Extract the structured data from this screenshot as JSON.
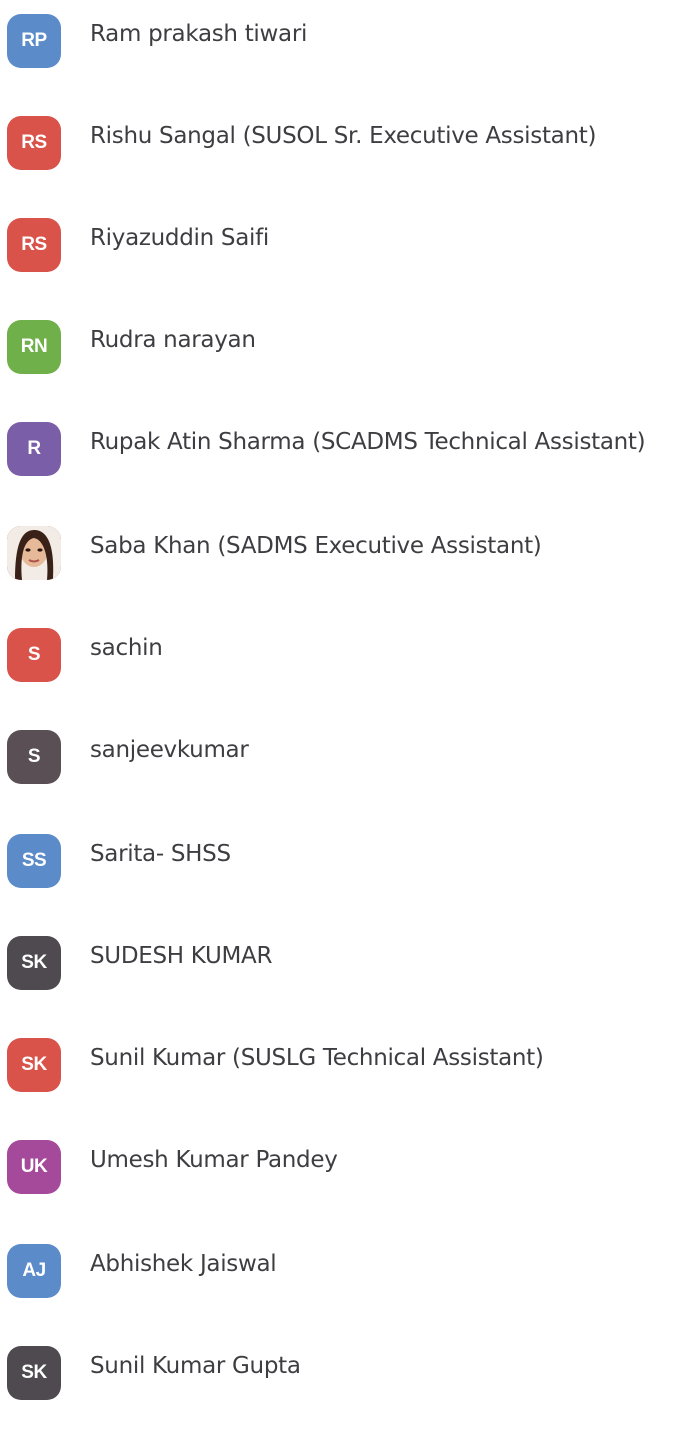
{
  "contacts": [
    {
      "initials": "RP",
      "name": "Ram prakash tiwari",
      "color": "#5b8bc8"
    },
    {
      "initials": "RS",
      "name": "Rishu Sangal (SUSOL Sr. Executive Assistant)",
      "color": "#d9534a"
    },
    {
      "initials": "RS",
      "name": "Riyazuddin Saifi",
      "color": "#d9534a"
    },
    {
      "initials": "RN",
      "name": "Rudra narayan",
      "color": "#6fb04a"
    },
    {
      "initials": "R",
      "name": "Rupak Atin Sharma (SCADMS Technical Assistant)",
      "color": "#7b5ea8"
    },
    {
      "initials": "",
      "name": "Saba Khan (SADMS Executive Assistant)",
      "color": "",
      "photo": true
    },
    {
      "initials": "S",
      "name": "sachin",
      "color": "#d9534a"
    },
    {
      "initials": "S",
      "name": "sanjeevkumar",
      "color": "#5a4f55"
    },
    {
      "initials": "SS",
      "name": "Sarita- SHSS",
      "color": "#5b8bc8"
    },
    {
      "initials": "SK",
      "name": "SUDESH KUMAR",
      "color": "#4e4a50"
    },
    {
      "initials": "SK",
      "name": "Sunil Kumar (SUSLG Technical Assistant)",
      "color": "#d9534a"
    },
    {
      "initials": "UK",
      "name": "Umesh Kumar Pandey",
      "color": "#a54a9a"
    },
    {
      "initials": "AJ",
      "name": "Abhishek Jaiswal",
      "color": "#5b8bc8"
    },
    {
      "initials": "SK",
      "name": "Sunil Kumar Gupta",
      "color": "#4e4a50"
    }
  ]
}
